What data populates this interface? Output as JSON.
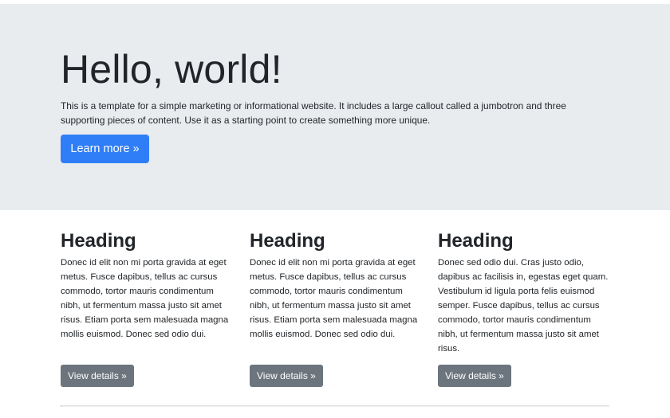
{
  "jumbotron": {
    "title": "Hello, world!",
    "lead": "This is a template for a simple marketing or informational website. It includes a large callout called a jumbotron and three supporting pieces of content. Use it as a starting point to create something more unique.",
    "button_label": "Learn more »"
  },
  "columns": [
    {
      "heading": "Heading",
      "body": "Donec id elit non mi porta gravida at eget metus. Fusce dapibus, tellus ac cursus commodo, tortor mauris condimentum nibh, ut fermentum massa justo sit amet risus. Etiam porta sem malesuada magna mollis euismod. Donec sed odio dui.",
      "button_label": "View details »"
    },
    {
      "heading": "Heading",
      "body": "Donec id elit non mi porta gravida at eget metus. Fusce dapibus, tellus ac cursus commodo, tortor mauris condimentum nibh, ut fermentum massa justo sit amet risus. Etiam porta sem malesuada magna mollis euismod. Donec sed odio dui.",
      "button_label": "View details »"
    },
    {
      "heading": "Heading",
      "body": "Donec sed odio dui. Cras justo odio, dapibus ac facilisis in, egestas eget quam. Vestibulum id ligula porta felis euismod semper. Fusce dapibus, tellus ac cursus commodo, tortor mauris condimentum nibh, ut fermentum massa justo sit amet risus.",
      "button_label": "View details »"
    }
  ],
  "colors": {
    "jumbotron_bg": "#e9ecef",
    "primary": "#2f7ef7",
    "secondary": "#6c757d",
    "text": "#212529"
  }
}
